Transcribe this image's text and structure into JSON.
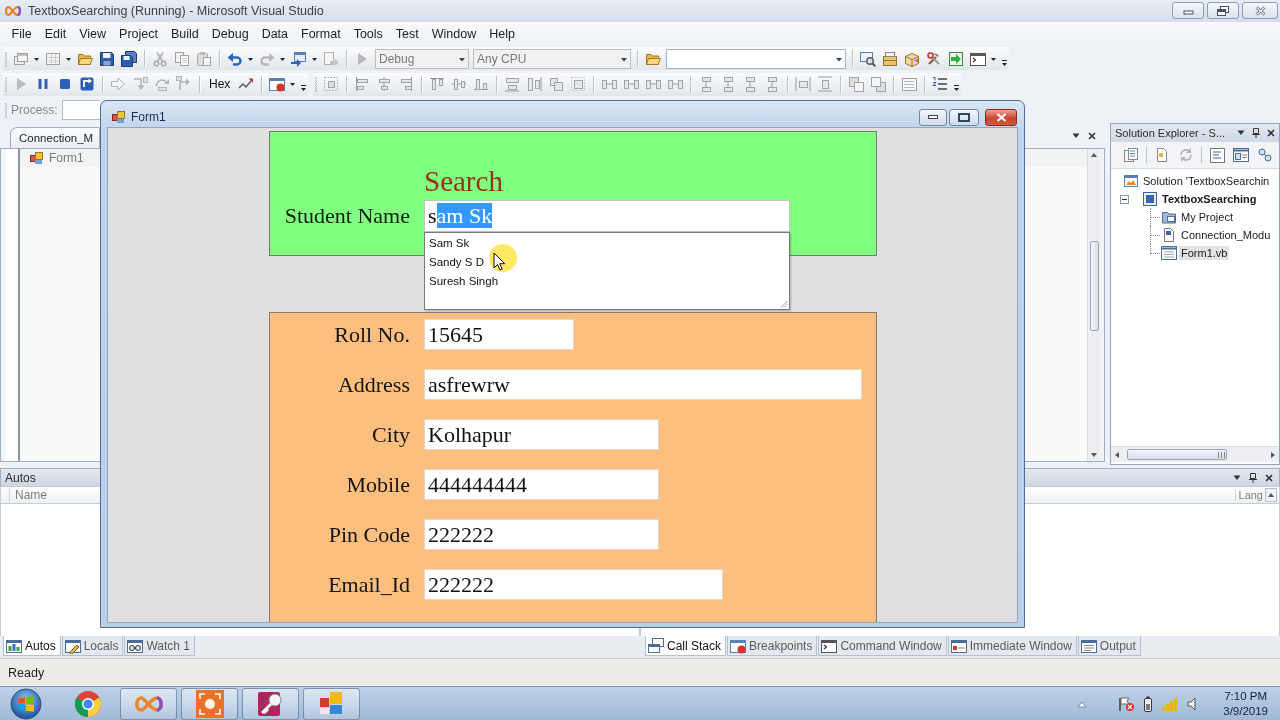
{
  "window": {
    "title": "TextboxSearching (Running) - Microsoft Visual Studio"
  },
  "menu": [
    "File",
    "Edit",
    "View",
    "Project",
    "Build",
    "Debug",
    "Data",
    "Format",
    "Tools",
    "Test",
    "Window",
    "Help"
  ],
  "toolbar": {
    "configuration": {
      "value": "Debug",
      "disabled": true
    },
    "platform": {
      "value": "Any CPU",
      "disabled": true
    },
    "hex_button": "Hex",
    "process_label": "Process:"
  },
  "editor": {
    "tab": "Connection_M",
    "class_dropdown": "Form1"
  },
  "solution_explorer": {
    "title": "Solution Explorer - S...",
    "tree": [
      {
        "label": "Solution 'TextboxSearchin",
        "selected": false,
        "children": [
          {
            "label": "TextboxSearching",
            "selected": false,
            "expanded": true,
            "children": [
              {
                "label": "My Project",
                "selected": false
              },
              {
                "label": "Connection_Modu",
                "selected": false
              },
              {
                "label": "Form1.vb",
                "selected": true
              }
            ]
          }
        ]
      }
    ]
  },
  "form": {
    "title": "Form1",
    "search": {
      "heading": "Search",
      "label": "Student Name",
      "typed": "s",
      "completion": "am Sk",
      "suggestions": [
        {
          "text": "Sam Sk",
          "selected": false
        },
        {
          "text": "Sandy S D",
          "selected": false
        },
        {
          "text": "Suresh Singh",
          "selected": false
        }
      ]
    },
    "details": [
      {
        "label": "Roll No.",
        "value": "15645"
      },
      {
        "label": "Address",
        "value": "asfrewrw"
      },
      {
        "label": "City",
        "value": "Kolhapur"
      },
      {
        "label": "Mobile",
        "value": "444444444"
      },
      {
        "label": "Pin Code",
        "value": "222222"
      },
      {
        "label": "Email_Id",
        "value": "222222"
      }
    ]
  },
  "autos": {
    "title": "Autos",
    "columns": [
      "Name"
    ],
    "tabs": [
      {
        "label": "Autos",
        "selected": true
      },
      {
        "label": "Locals",
        "selected": false
      },
      {
        "label": "Watch 1",
        "selected": false
      }
    ]
  },
  "call_stack": {
    "columns": [
      "Lang"
    ],
    "tabs": [
      {
        "label": "Call Stack",
        "selected": true
      },
      {
        "label": "Breakpoints",
        "selected": false
      },
      {
        "label": "Command Window",
        "selected": false
      },
      {
        "label": "Immediate Window",
        "selected": false
      },
      {
        "label": "Output",
        "selected": false
      }
    ]
  },
  "status_bar": "Ready",
  "taskbar": {
    "apps": [
      {
        "running": false
      },
      {
        "running": true
      },
      {
        "running": true
      },
      {
        "running": true
      },
      {
        "running": true
      }
    ],
    "time": "7:10 PM",
    "date": "3/9/2019"
  }
}
